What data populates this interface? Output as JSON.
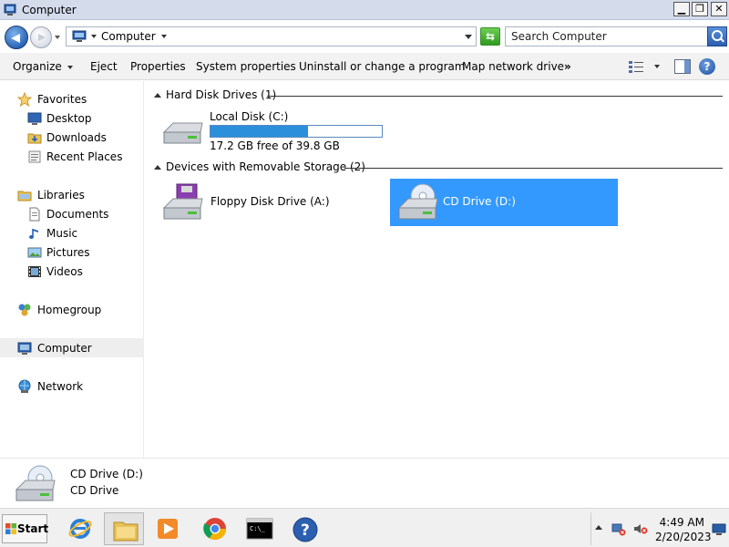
{
  "window": {
    "title": "Computer",
    "minimize_glyph": "▁",
    "maximize_glyph": "❐",
    "close_glyph": "✕"
  },
  "address": {
    "crumb": "Computer"
  },
  "search": {
    "placeholder": "Search Computer"
  },
  "toolbar": {
    "organize": "Organize",
    "eject": "Eject",
    "properties": "Properties",
    "system_properties": "System properties",
    "uninstall": "Uninstall or change a program",
    "map_drive": "Map network drive",
    "more": "»",
    "help": "?"
  },
  "sidebar": {
    "favorites": "Favorites",
    "desktop": "Desktop",
    "downloads": "Downloads",
    "recent_places": "Recent Places",
    "libraries": "Libraries",
    "documents": "Documents",
    "music": "Music",
    "pictures": "Pictures",
    "videos": "Videos",
    "homegroup": "Homegroup",
    "computer": "Computer",
    "network": "Network"
  },
  "groups": {
    "hard_disks": "Hard Disk Drives (1)",
    "removable": "Devices with Removable Storage (2)"
  },
  "drives": {
    "local_disk": {
      "name": "Local Disk (C:)",
      "free_text": "17.2 GB free of 39.8 GB",
      "used_fraction": 0.568
    },
    "floppy": {
      "name": "Floppy Disk Drive (A:)"
    },
    "cd": {
      "name": "CD Drive (D:)"
    }
  },
  "details": {
    "name": "CD Drive (D:)",
    "type": "CD Drive"
  },
  "taskbar": {
    "start": "Start",
    "time": "4:49 AM",
    "date": "2/20/2023"
  },
  "colors": {
    "selection": "#3399ff",
    "capacity_fill": "#2c8fdc",
    "titlebar": "#d4dcec"
  }
}
